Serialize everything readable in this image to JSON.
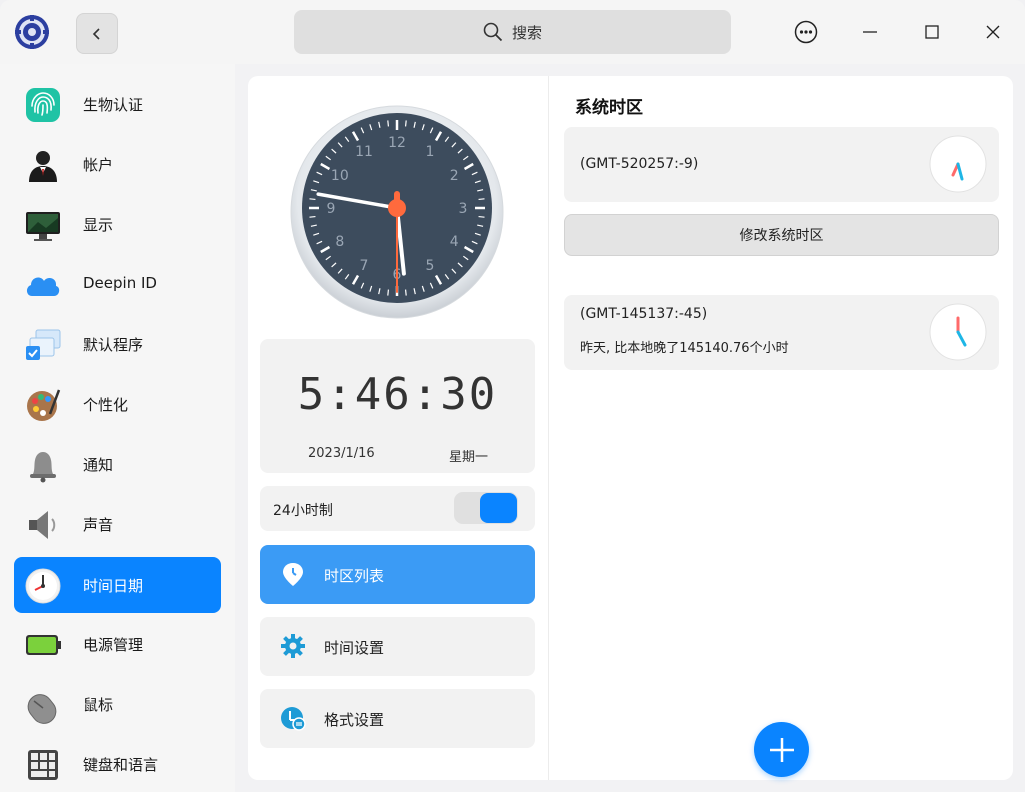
{
  "titlebar": {
    "search_placeholder": "搜索"
  },
  "sidebar": {
    "items": [
      {
        "label": "生物认证",
        "icon": "fingerprint-icon"
      },
      {
        "label": "帐户",
        "icon": "account-icon"
      },
      {
        "label": "显示",
        "icon": "display-icon"
      },
      {
        "label": "Deepin ID",
        "icon": "cloud-icon"
      },
      {
        "label": "默认程序",
        "icon": "default-apps-icon"
      },
      {
        "label": "个性化",
        "icon": "palette-icon"
      },
      {
        "label": "通知",
        "icon": "bell-icon"
      },
      {
        "label": "声音",
        "icon": "speaker-icon"
      },
      {
        "label": "时间日期",
        "icon": "clock-icon",
        "active": true
      },
      {
        "label": "电源管理",
        "icon": "battery-icon"
      },
      {
        "label": "鼠标",
        "icon": "mouse-icon"
      },
      {
        "label": "键盘和语言",
        "icon": "keyboard-icon"
      }
    ]
  },
  "clock": {
    "digital_time": "5:46:30",
    "date": "2023/1/16",
    "weekday": "星期一",
    "dial_numbers": [
      "12",
      "1",
      "2",
      "3",
      "4",
      "5",
      "6",
      "7",
      "8",
      "9",
      "10",
      "11"
    ],
    "hour": 5,
    "minute": 46,
    "second": 30
  },
  "format_toggle": {
    "label": "24小时制",
    "enabled": true
  },
  "menu": {
    "timezone_list": "时区列表",
    "time_settings": "时间设置",
    "format_settings": "格式设置"
  },
  "system_timezone": {
    "title": "系统时区",
    "zone_name": "(GMT-520257:-9)",
    "change_button": "修改系统时区"
  },
  "timezone_list": [
    {
      "name": "(GMT-145137:-45)",
      "description": "昨天, 比本地晚了145140.76个小时"
    }
  ],
  "colors": {
    "accent": "#0a84ff",
    "dial_face": "#3a4a5c",
    "hand_red": "#ff5b3a"
  }
}
